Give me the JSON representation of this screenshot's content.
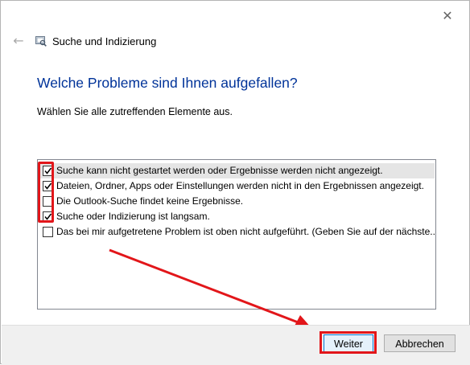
{
  "window": {
    "close_glyph": "✕",
    "back_glyph": "←",
    "app_title": "Suche und Indizierung",
    "icon": "search-indexing-app-icon"
  },
  "main": {
    "heading": "Welche Probleme sind Ihnen aufgefallen?",
    "instruction": "Wählen Sie alle zutreffenden Elemente aus.",
    "problems": [
      {
        "label": "Suche kann nicht gestartet werden oder Ergebnisse werden nicht angezeigt.",
        "checked": true,
        "selected": true
      },
      {
        "label": "Dateien, Ordner, Apps oder Einstellungen werden nicht in den Ergebnissen angezeigt.",
        "checked": true,
        "selected": false
      },
      {
        "label": "Die Outlook-Suche findet keine Ergebnisse.",
        "checked": false,
        "selected": false
      },
      {
        "label": "Suche oder Indizierung ist langsam.",
        "checked": true,
        "selected": false
      },
      {
        "label": "Das bei mir aufgetretene Problem ist oben nicht aufgeführt. (Geben Sie auf der nächste...",
        "checked": false,
        "selected": false
      }
    ]
  },
  "footer": {
    "next_label": "Weiter",
    "cancel_label": "Abbrechen"
  },
  "colors": {
    "heading": "#003399",
    "annotation": "#e2161a",
    "selected_row": "#e5e5e5"
  }
}
